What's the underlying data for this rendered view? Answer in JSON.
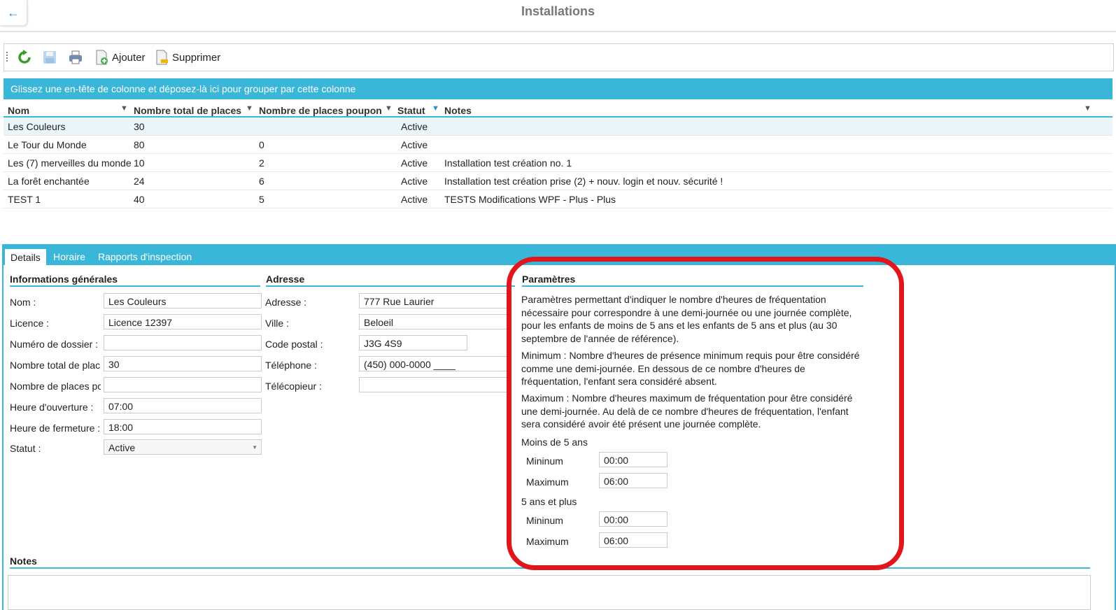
{
  "window": {
    "title": "Installations",
    "back_icon": "arrow-left-icon"
  },
  "toolbar": {
    "refresh_icon": "refresh-icon",
    "save_icon": "save-icon",
    "print_icon": "print-icon",
    "add_label": "Ajouter",
    "delete_label": "Supprimer"
  },
  "grid": {
    "group_hint": "Glissez une en-tête de colonne et déposez-là ici pour grouper par cette colonne",
    "columns": [
      "Nom",
      "Nombre total de places",
      "Nombre de places poupon",
      "Statut",
      "Notes"
    ],
    "rows": [
      {
        "nom": "Les Couleurs",
        "total": "30",
        "poupon": "",
        "statut": "Active",
        "notes": ""
      },
      {
        "nom": "Le Tour du Monde",
        "total": "80",
        "poupon": "0",
        "statut": "Active",
        "notes": ""
      },
      {
        "nom": "Les (7) merveilles du monde",
        "total": "10",
        "poupon": "2",
        "statut": "Active",
        "notes": "Installation test création no. 1"
      },
      {
        "nom": "La forêt enchantée",
        "total": "24",
        "poupon": "6",
        "statut": "Active",
        "notes": "Installation test création prise (2) + nouv. login et nouv. sécurité !"
      },
      {
        "nom": "TEST 1",
        "total": "40",
        "poupon": "5",
        "statut": "Active",
        "notes": "TESTS Modifications WPF - Plus - Plus"
      }
    ]
  },
  "tabs": [
    "Details",
    "Horaire",
    "Rapports d'inspection"
  ],
  "general": {
    "heading": "Informations générales",
    "fields": [
      {
        "label": "Nom :",
        "value": "Les Couleurs"
      },
      {
        "label": "Licence :",
        "value": "Licence 12397"
      },
      {
        "label": "Numéro de dossier :",
        "value": ""
      },
      {
        "label": "Nombre total de plac",
        "value": "30"
      },
      {
        "label": "Nombre de places pc",
        "value": ""
      },
      {
        "label": "Heure d'ouverture :",
        "value": "07:00"
      },
      {
        "label": "Heure de fermeture :",
        "value": "18:00"
      }
    ],
    "statut_label": "Statut :",
    "statut_value": "Active"
  },
  "address": {
    "heading": "Adresse",
    "fields": [
      {
        "label": "Adresse :",
        "value": "777 Rue Laurier"
      },
      {
        "label": "Ville :",
        "value": "Beloeil"
      },
      {
        "label": "Code postal :",
        "value": "J3G 4S9"
      },
      {
        "label": "Téléphone :",
        "value": "(450) 000-0000 ____"
      },
      {
        "label": "Télécopieur :",
        "value": ""
      }
    ]
  },
  "params": {
    "heading": "Paramètres",
    "p1": "Paramètres permettant d'indiquer le nombre d'heures de fréquentation nécessaire pour correspondre à une demi-journée ou une journée complète, pour les enfants de moins de 5 ans et les enfants de 5 ans et plus (au 30 septembre de l'année de référence).",
    "p2": "Minimum : Nombre d'heures de présence minimum requis pour être considéré comme une demi-journée. En dessous de ce nombre d'heures de fréquentation, l'enfant sera considéré absent.",
    "p3": "Maximum : Nombre d'heures maximum de fréquentation pour être considéré une demi-journée. Au delà de ce nombre d'heures de fréquentation, l'enfant sera considéré avoir été présent une journée complète.",
    "under5_label": "Moins de 5 ans",
    "over5_label": "5 ans et plus",
    "min_label": "Mininum",
    "max_label": "Maximum",
    "under5_min": "00:00",
    "under5_max": "06:00",
    "over5_min": "00:00",
    "over5_max": "06:00"
  },
  "notes": {
    "heading": "Notes",
    "value": ""
  },
  "highlight_color": "#e0161c",
  "accent_color": "#3ab7d8"
}
